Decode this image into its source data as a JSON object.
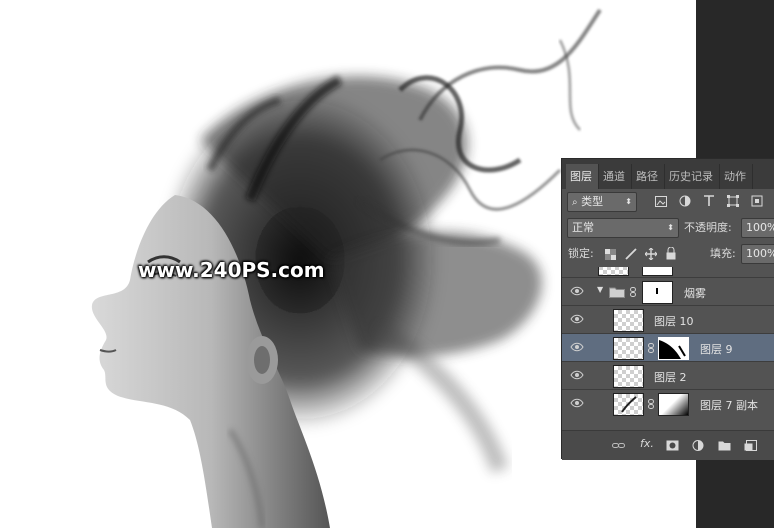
{
  "watermark": "www.240PS.com",
  "panel": {
    "tabs": [
      {
        "label": "图层"
      },
      {
        "label": "通道"
      },
      {
        "label": "路径"
      },
      {
        "label": "历史记录"
      },
      {
        "label": "动作"
      }
    ],
    "filter_kind": "类型",
    "blend_mode": "正常",
    "opacity_label": "不透明度:",
    "opacity_value": "100%",
    "lock_label": "锁定:",
    "fill_label": "填充:",
    "fill_value": "100%",
    "group_name": "烟雾",
    "layers": [
      {
        "name": "图层 10"
      },
      {
        "name": "图层 9"
      },
      {
        "name": "图层 2"
      },
      {
        "name": "图层 7 副本"
      }
    ]
  },
  "colors": {
    "panel_bg": "#535353",
    "tab_bar_bg": "#3b3b3b",
    "selection": "#5f6d80",
    "right_strip": "#282828"
  }
}
